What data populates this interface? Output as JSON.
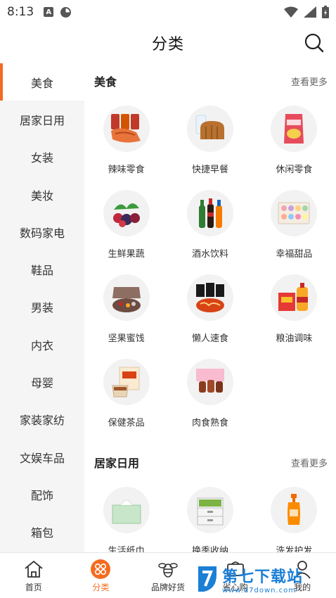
{
  "status_bar": {
    "time": "8:13"
  },
  "header": {
    "title": "分类"
  },
  "sidebar": {
    "items": [
      {
        "label": "美食",
        "active": true
      },
      {
        "label": "居家日用"
      },
      {
        "label": "女装"
      },
      {
        "label": "美妆"
      },
      {
        "label": "数码家电"
      },
      {
        "label": "鞋品"
      },
      {
        "label": "男装"
      },
      {
        "label": "内衣"
      },
      {
        "label": "母婴"
      },
      {
        "label": "家装家纺"
      },
      {
        "label": "文娱车品"
      },
      {
        "label": "配饰"
      },
      {
        "label": "箱包"
      }
    ]
  },
  "sections": [
    {
      "title": "美食",
      "more": "查看更多",
      "items": [
        {
          "label": "辣味零食",
          "icon": "spicy-snack-icon"
        },
        {
          "label": "快捷早餐",
          "icon": "bread-milk-icon"
        },
        {
          "label": "休闲零食",
          "icon": "chips-bag-icon"
        },
        {
          "label": "生鲜果蔬",
          "icon": "fresh-fruit-icon"
        },
        {
          "label": "酒水饮料",
          "icon": "drink-bottles-icon"
        },
        {
          "label": "幸福甜品",
          "icon": "macaron-box-icon"
        },
        {
          "label": "坚果蜜饯",
          "icon": "nut-box-icon"
        },
        {
          "label": "懒人速食",
          "icon": "instant-noodle-icon"
        },
        {
          "label": "粮油调味",
          "icon": "cooking-oil-icon"
        },
        {
          "label": "保健茶品",
          "icon": "tea-box-icon"
        },
        {
          "label": "肉食熟食",
          "icon": "cooked-meat-icon"
        }
      ]
    },
    {
      "title": "居家日用",
      "more": "查看更多",
      "items": [
        {
          "label": "生活纸巾",
          "icon": "tissue-box-icon"
        },
        {
          "label": "换季收纳",
          "icon": "storage-drawer-icon"
        },
        {
          "label": "洗发护发",
          "icon": "shampoo-bottle-icon"
        }
      ]
    }
  ],
  "bottom_nav": [
    {
      "label": "首页",
      "icon": "home-icon"
    },
    {
      "label": "分类",
      "icon": "category-icon",
      "active": true
    },
    {
      "label": "品牌好货",
      "icon": "bee-icon"
    },
    {
      "label": "省心购",
      "icon": "cart-icon"
    },
    {
      "label": "我的",
      "icon": "user-icon"
    }
  ],
  "watermark": {
    "title": "第七下载站",
    "url": "www.d7down.com"
  },
  "colors": {
    "accent": "#f36c21",
    "sidebar_bg": "#f5f5f5",
    "watermark_blue": "#1b7fd6"
  }
}
